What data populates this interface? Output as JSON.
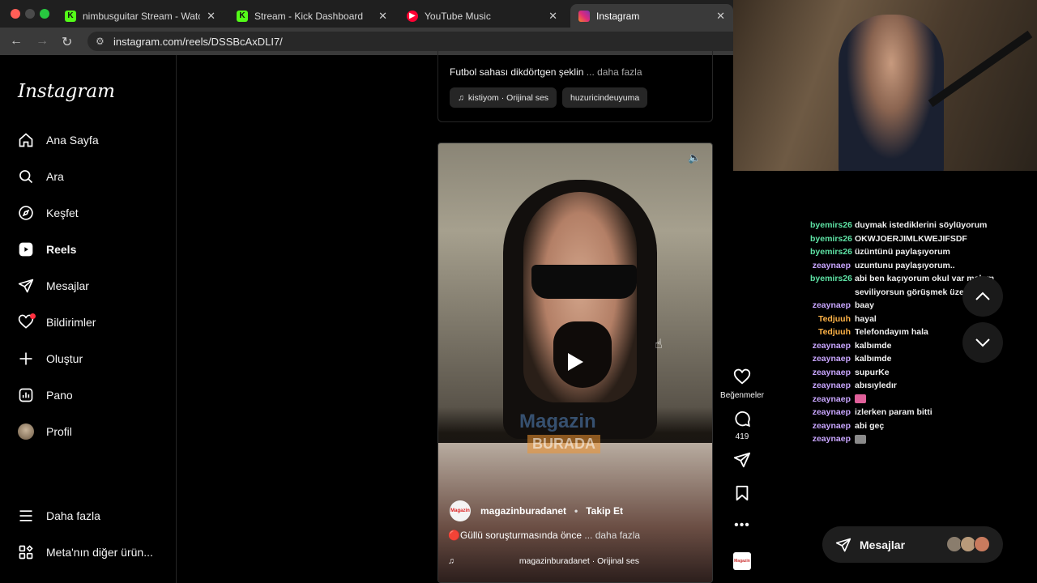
{
  "browser": {
    "tabs": [
      {
        "label": "nimbusguitar Stream - Watch",
        "icon": "kick-icon",
        "color": "#53fc18"
      },
      {
        "label": "Stream - Kick Dashboard",
        "icon": "kick-icon",
        "color": "#53fc18"
      },
      {
        "label": "YouTube Music",
        "icon": "youtube-music-icon",
        "color": "#ff0033"
      },
      {
        "label": "Instagram",
        "icon": "instagram-icon",
        "color": "#d62976"
      }
    ],
    "url": "instagram.com/reels/DSSBcAxDLI7/"
  },
  "sidebar": {
    "logo": "Instagram",
    "items": [
      {
        "label": "Ana Sayfa",
        "icon": "home-icon"
      },
      {
        "label": "Ara",
        "icon": "search-icon"
      },
      {
        "label": "Keşfet",
        "icon": "compass-icon"
      },
      {
        "label": "Reels",
        "icon": "reels-icon"
      },
      {
        "label": "Mesajlar",
        "icon": "send-icon"
      },
      {
        "label": "Bildirimler",
        "icon": "heart-icon"
      },
      {
        "label": "Oluştur",
        "icon": "plus-icon"
      },
      {
        "label": "Pano",
        "icon": "dashboard-icon"
      },
      {
        "label": "Profil",
        "icon": "avatar"
      }
    ],
    "more": "Daha fazla",
    "meta": "Meta'nın diğer ürün..."
  },
  "prev_post": {
    "caption": "Futbol sahası dikdörtgen şeklin",
    "more": "... daha fazla",
    "audio": "kistiyom · Orijinal ses",
    "tag": "huzuricindeuyuma"
  },
  "reel": {
    "watermark_top": "Magazin",
    "watermark_bottom": "BURADA",
    "avatar_text": "Magazin",
    "username": "magazinburadanet",
    "separator": "•",
    "follow": "Takip Et",
    "caption": "🔴Güllü soruşturmasında önce",
    "more": "... daha fazla",
    "audio": "magazinburadanet · Orijinal ses",
    "likes_label": "Beğenmeler",
    "comments_count": "419",
    "thumb_text": "Magazin"
  },
  "chat": [
    {
      "user": "byemirs26",
      "text": "duymak istediklerini söylüyorum",
      "color": "#5ee3a5"
    },
    {
      "user": "byemirs26",
      "text": "OKWJOERJIMLKWEJIFSDF",
      "color": "#5ee3a5"
    },
    {
      "user": "byemirs26",
      "text": "üzüntünü paylaşıyorum",
      "color": "#5ee3a5"
    },
    {
      "user": "zeaynaep",
      "text": "uzuntunu paylaşıyorum..",
      "color": "#c9a6ff"
    },
    {
      "user": "byemirs26",
      "text": "abi ben kaçıyorum okul var malum seviliyorsun görüşmek üzere abim",
      "color": "#5ee3a5"
    },
    {
      "user": "zeaynaep",
      "text": "baay",
      "color": "#c9a6ff"
    },
    {
      "user": "Tedjuuh",
      "text": "hayal",
      "color": "#ffb347"
    },
    {
      "user": "Tedjuuh",
      "text": "Telefondayım hala",
      "color": "#ffb347"
    },
    {
      "user": "zeaynaep",
      "text": "kalbımde",
      "color": "#c9a6ff"
    },
    {
      "user": "zeaynaep",
      "text": "kalbımde",
      "color": "#c9a6ff"
    },
    {
      "user": "zeaynaep",
      "text": "supurKe",
      "color": "#c9a6ff"
    },
    {
      "user": "zeaynaep",
      "text": "abısıyledır",
      "color": "#c9a6ff"
    },
    {
      "user": "zeaynaep",
      "text": "",
      "emote": "#e0609a",
      "color": "#c9a6ff"
    },
    {
      "user": "zeaynaep",
      "text": "izlerken param bitti",
      "color": "#c9a6ff"
    },
    {
      "user": "zeaynaep",
      "text": "abi geç",
      "color": "#c9a6ff"
    },
    {
      "user": "zeaynaep",
      "text": "",
      "emote": "#8a8a8a",
      "color": "#c9a6ff"
    }
  ],
  "messages_pill": "Mesajlar"
}
